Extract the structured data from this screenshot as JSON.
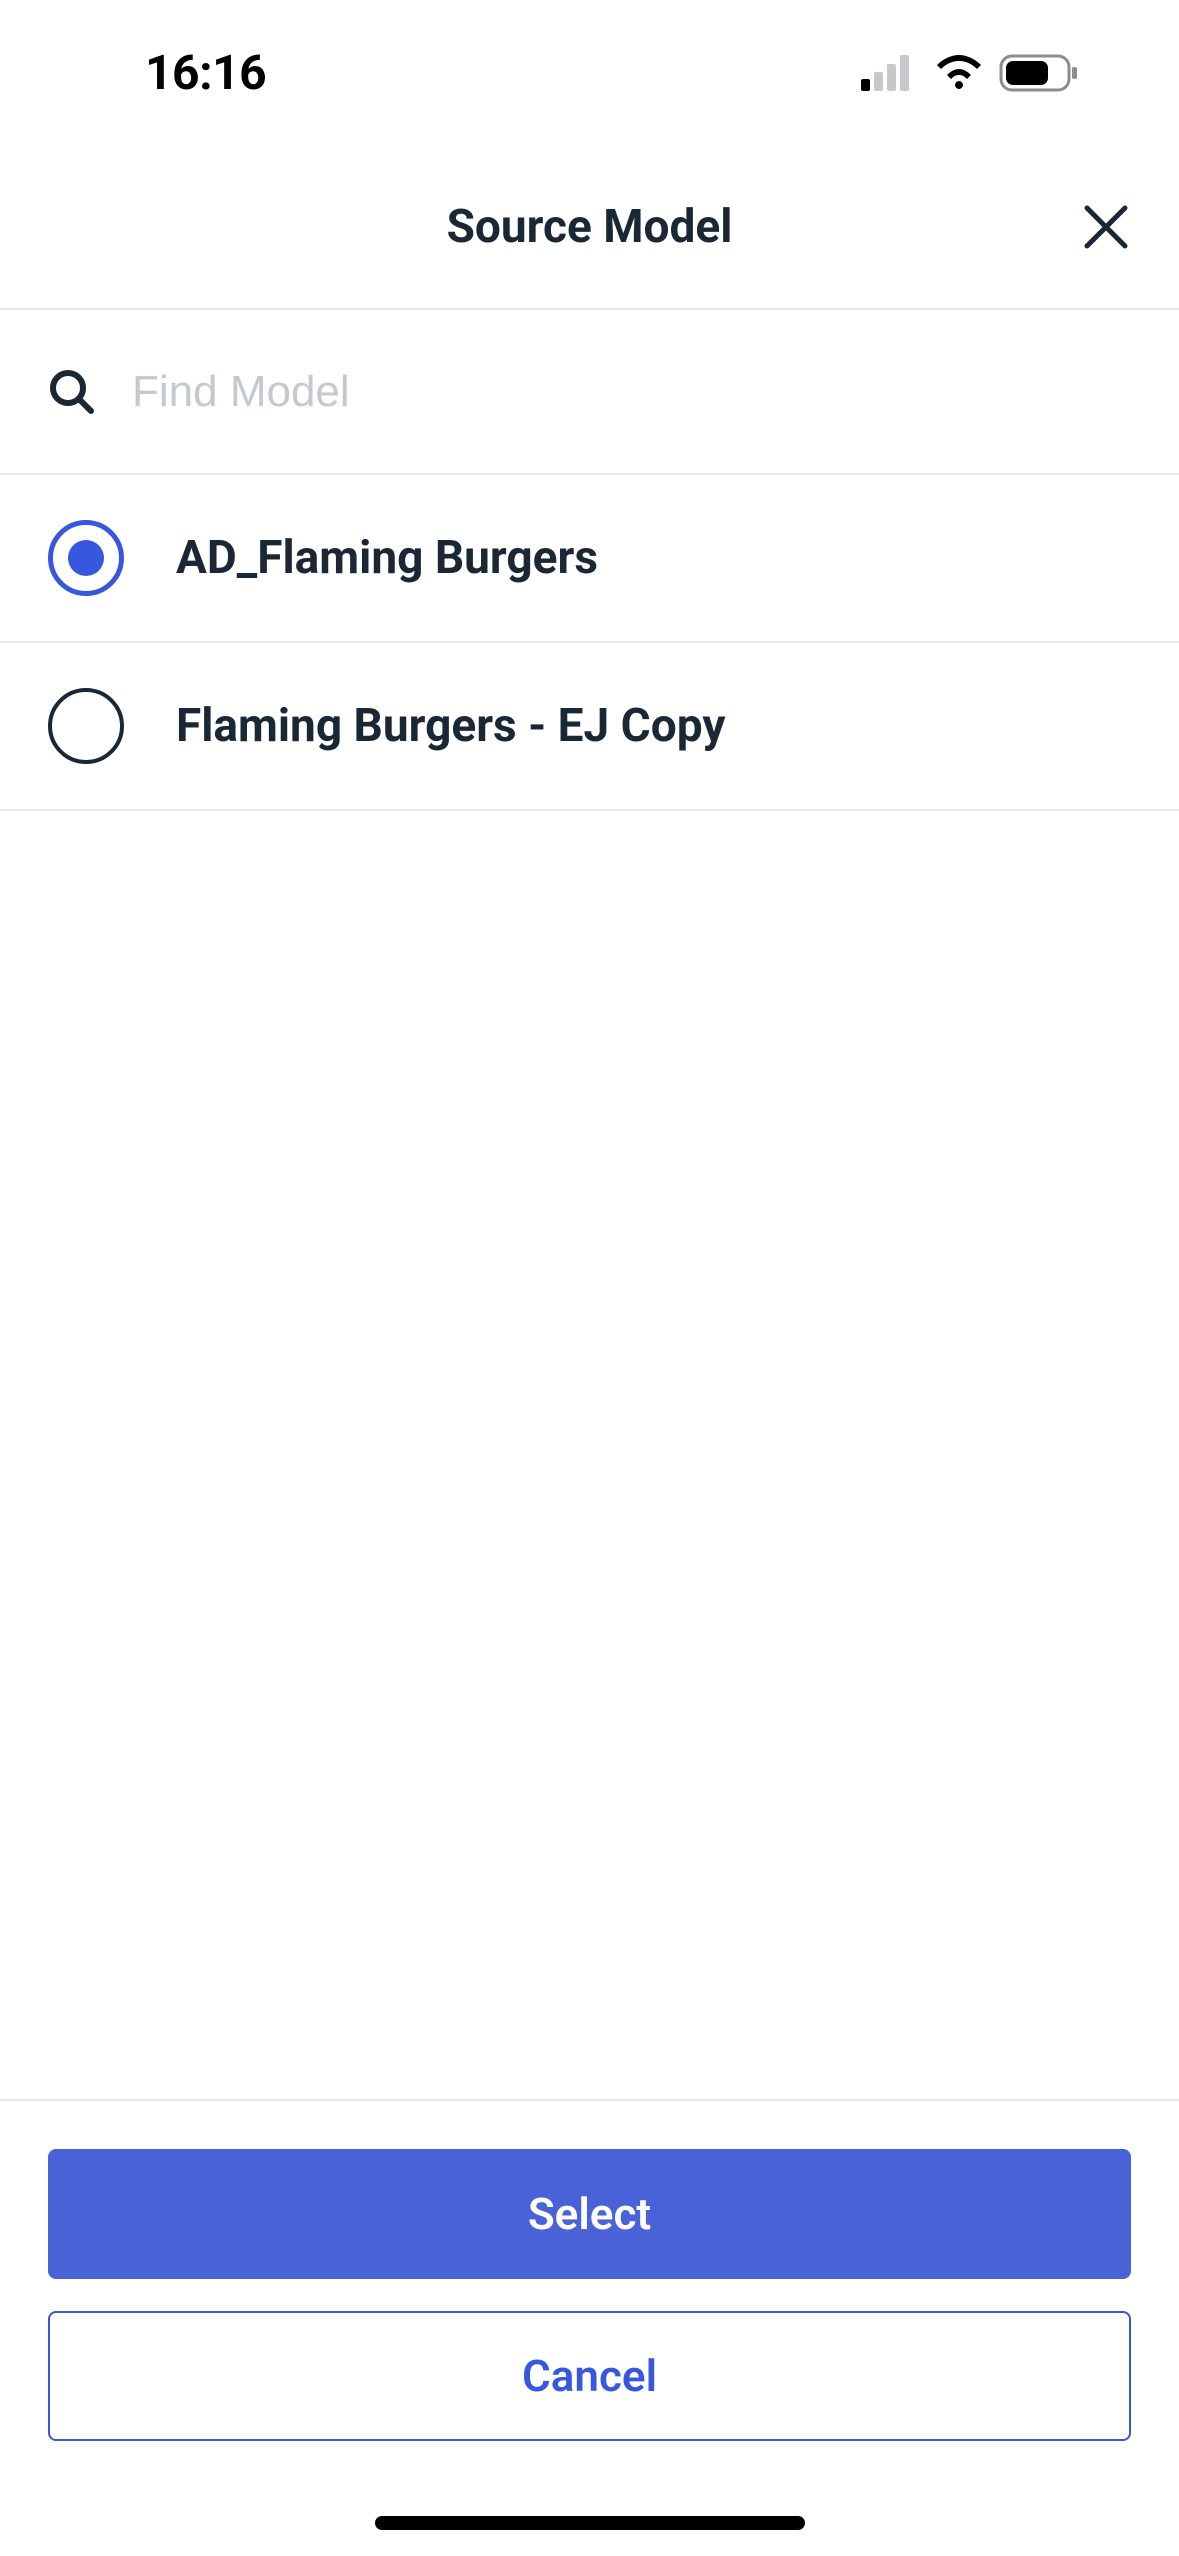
{
  "statusBar": {
    "time": "16:16"
  },
  "header": {
    "title": "Source Model"
  },
  "search": {
    "placeholder": "Find Model",
    "value": ""
  },
  "items": [
    {
      "label": "AD_Flaming Burgers",
      "selected": true
    },
    {
      "label": "Flaming Burgers - EJ Copy",
      "selected": false
    }
  ],
  "actions": {
    "select": "Select",
    "cancel": "Cancel"
  },
  "colors": {
    "primary": "#4a62d8",
    "text": "#1a2735",
    "accent": "#3657de"
  }
}
